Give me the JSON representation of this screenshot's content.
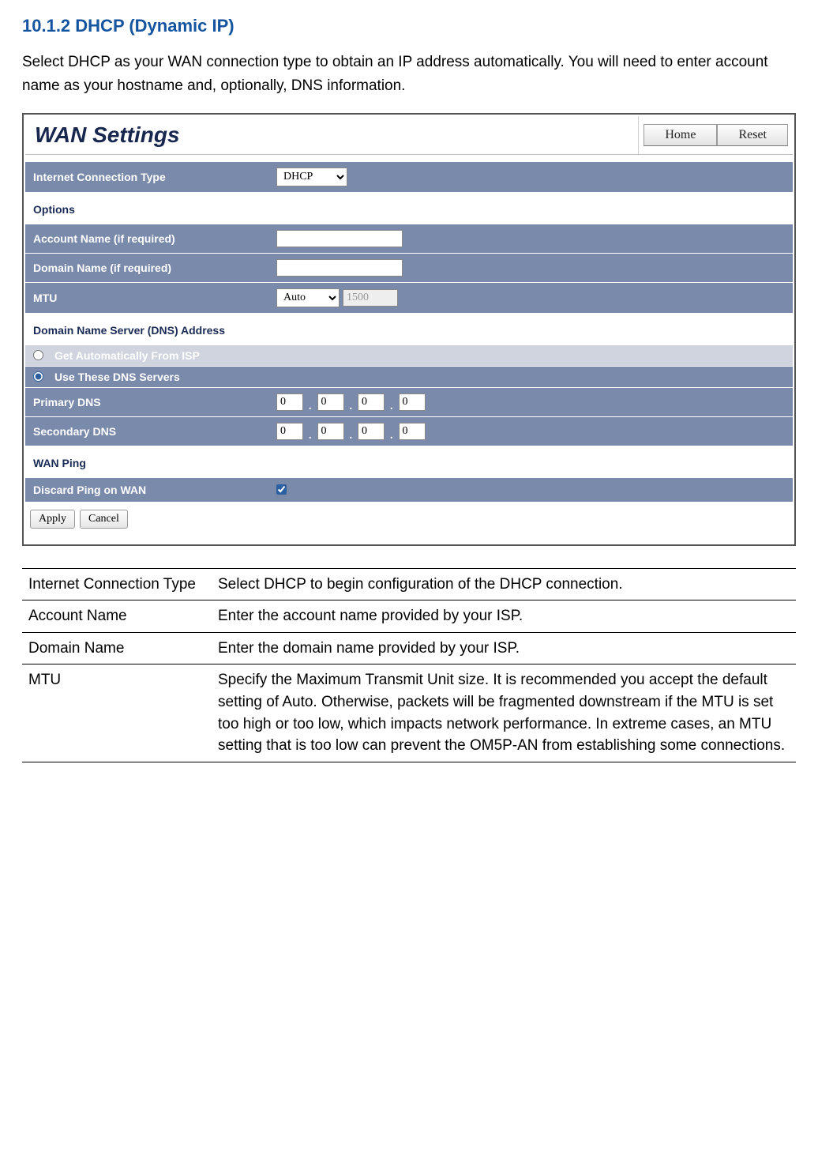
{
  "heading": "10.1.2 DHCP (Dynamic  IP)",
  "intro": "Select DHCP as your WAN connection type to obtain an IP address automatically. You will need to enter account name as your hostname and, optionally, DNS information.",
  "panel": {
    "title": "WAN Settings",
    "buttons": {
      "home": "Home",
      "reset": "Reset"
    },
    "conn_type": {
      "label": "Internet Connection Type",
      "value": "DHCP"
    },
    "options_header": "Options",
    "account_name": {
      "label": "Account Name (if required)",
      "value": ""
    },
    "domain_name": {
      "label": "Domain Name (if required)",
      "value": ""
    },
    "mtu": {
      "label": "MTU",
      "mode": "Auto",
      "value": "1500"
    },
    "dns_header": "Domain Name Server (DNS) Address",
    "dns_mode_auto": "Get Automatically From ISP",
    "dns_mode_manual": "Use These DNS Servers",
    "primary_dns": {
      "label": "Primary DNS",
      "ip": [
        "0",
        "0",
        "0",
        "0"
      ]
    },
    "secondary_dns": {
      "label": "Secondary DNS",
      "ip": [
        "0",
        "0",
        "0",
        "0"
      ]
    },
    "wan_ping_header": "WAN Ping",
    "discard_ping": {
      "label": "Discard Ping on WAN",
      "checked": true
    },
    "footer": {
      "apply": "Apply",
      "cancel": "Cancel"
    }
  },
  "desc": [
    {
      "key": "Internet Connection Type",
      "val": "Select DHCP to begin configuration of the DHCP connection."
    },
    {
      "key": "Account Name",
      "val": "Enter the account name provided by your ISP."
    },
    {
      "key": "Domain Name",
      "val": "Enter the domain name provided by your ISP."
    },
    {
      "key": "MTU",
      "val": "Specify the Maximum Transmit Unit size. It is recommended you accept the default setting of Auto. Otherwise, packets will be fragmented downstream if the MTU is set too high or too low, which impacts network performance. In extreme cases, an MTU setting that is too low can prevent the OM5P-AN from establishing some connections."
    }
  ]
}
